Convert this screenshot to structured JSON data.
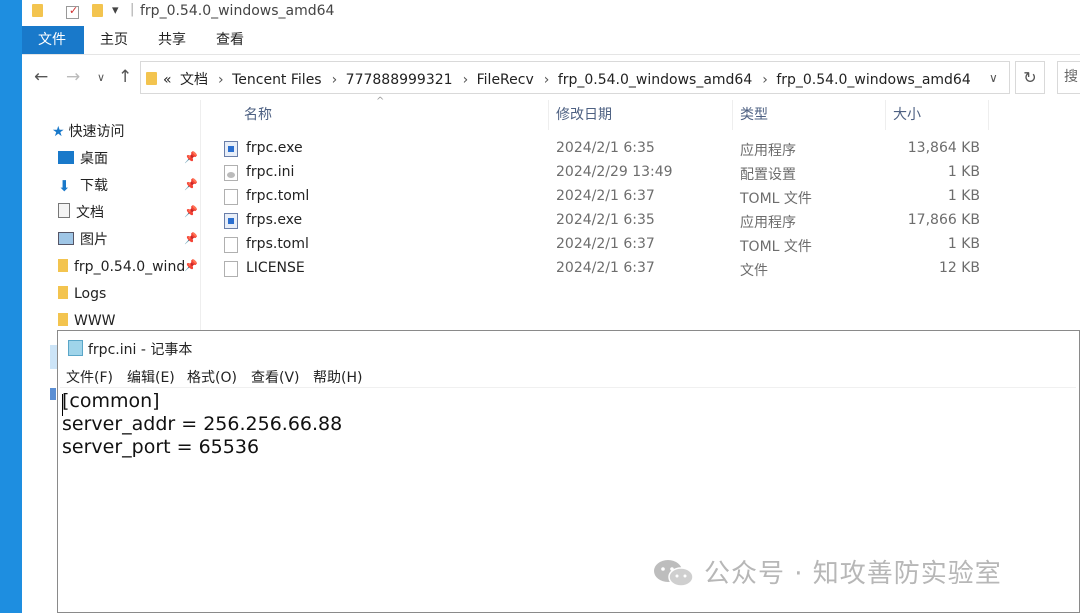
{
  "window": {
    "title": "frp_0.54.0_windows_amd64",
    "quick_access_sep": "|",
    "dropdown_glyph": "▾"
  },
  "ribbon": {
    "tabs": [
      "文件",
      "主页",
      "共享",
      "查看"
    ]
  },
  "nav": {
    "back": "←",
    "forward": "→",
    "recent": "∨",
    "up": "↑",
    "breadcrumb_prefix": "«",
    "breadcrumb": [
      "文档",
      "Tencent Files",
      "777888999321",
      "FileRecv",
      "frp_0.54.0_windows_amd64",
      "frp_0.54.0_windows_amd64"
    ],
    "chevron": "∨",
    "refresh": "↻",
    "search_placeholder": "搜"
  },
  "sidebar": {
    "header": "快速访问",
    "items": [
      {
        "label": "桌面",
        "icon": "desktop-icon",
        "pinned": true
      },
      {
        "label": "下载",
        "icon": "download-icon",
        "pinned": true
      },
      {
        "label": "文档",
        "icon": "document-icon",
        "pinned": true
      },
      {
        "label": "图片",
        "icon": "picture-icon",
        "pinned": true
      },
      {
        "label": "frp_0.54.0_wind",
        "icon": "folder-icon",
        "pinned": true
      },
      {
        "label": "Logs",
        "icon": "folder-icon",
        "pinned": false
      },
      {
        "label": "WWW",
        "icon": "folder-icon",
        "pinned": false
      }
    ]
  },
  "file_list": {
    "columns": [
      "名称",
      "修改日期",
      "类型",
      "大小"
    ],
    "sort_glyph": "^",
    "rows": [
      {
        "name": "frpc.exe",
        "date": "2024/2/1 6:35",
        "type": "应用程序",
        "size": "13,864 KB",
        "icon": "exe"
      },
      {
        "name": "frpc.ini",
        "date": "2024/2/29 13:49",
        "type": "配置设置",
        "size": "1 KB",
        "icon": "ini"
      },
      {
        "name": "frpc.toml",
        "date": "2024/2/1 6:37",
        "type": "TOML 文件",
        "size": "1 KB",
        "icon": "file"
      },
      {
        "name": "frps.exe",
        "date": "2024/2/1 6:35",
        "type": "应用程序",
        "size": "17,866 KB",
        "icon": "exe"
      },
      {
        "name": "frps.toml",
        "date": "2024/2/1 6:37",
        "type": "TOML 文件",
        "size": "1 KB",
        "icon": "file"
      },
      {
        "name": "LICENSE",
        "date": "2024/2/1 6:37",
        "type": "文件",
        "size": "12 KB",
        "icon": "file"
      }
    ]
  },
  "notepad": {
    "title": "frpc.ini - 记事本",
    "menu": [
      "文件(F)",
      "编辑(E)",
      "格式(O)",
      "查看(V)",
      "帮助(H)"
    ],
    "lines": [
      "[common]",
      "server_addr = 256.256.66.88",
      "server_port = 65536"
    ]
  },
  "watermark": {
    "text": "公众号 · 知攻善防实验室"
  },
  "colors": {
    "accent": "#1979ca",
    "folder": "#f3c44f",
    "desktop": "#1e8ee0"
  }
}
